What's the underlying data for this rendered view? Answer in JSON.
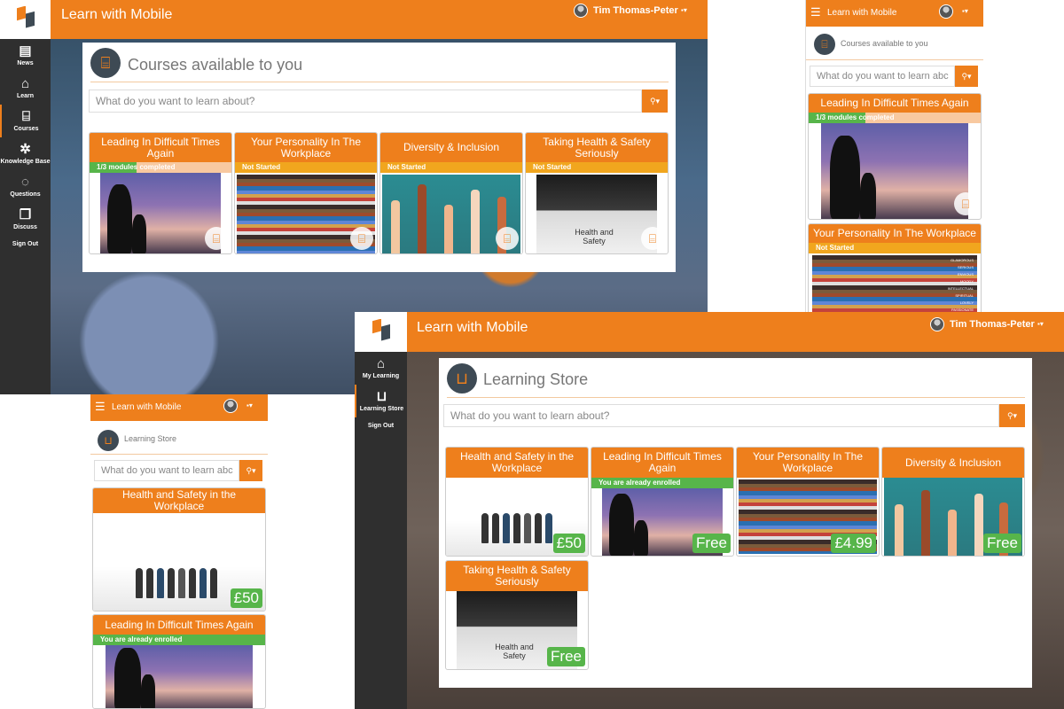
{
  "app": {
    "title": "Learn with Mobile",
    "user_name": "Tim Thomas-Peter"
  },
  "colors": {
    "accent": "#ee7f1c",
    "sidebar": "#2f2f2f",
    "success": "#57b54a",
    "warning": "#f1a61e"
  },
  "screen1": {
    "sidebar": [
      {
        "label": "News",
        "icon": "newspaper-icon"
      },
      {
        "label": "Learn",
        "icon": "graduation-cap-icon"
      },
      {
        "label": "Courses",
        "icon": "institution-icon"
      },
      {
        "label": "Knowledge Base",
        "icon": "atom-icon"
      },
      {
        "label": "Questions",
        "icon": "lightbulb-icon"
      },
      {
        "label": "Discuss",
        "icon": "chat-icon"
      },
      {
        "label": "Sign Out",
        "icon": ""
      }
    ],
    "page_title": "Courses available to you",
    "search_placeholder": "What do you want to learn about?",
    "courses": [
      {
        "title": "Leading In Difficult Times Again",
        "status": "1/3 modules completed",
        "progress": 0.33
      },
      {
        "title": "Your Personality In The Workplace",
        "status": "Not Started"
      },
      {
        "title": "Diversity & Inclusion",
        "status": "Not Started"
      },
      {
        "title": "Taking Health & Safety Seriously",
        "status": "Not Started"
      }
    ]
  },
  "mobile1": {
    "page_title": "Courses available to you",
    "search_placeholder": "What do you want to learn abc",
    "courses": [
      {
        "title": "Leading In Difficult Times Again",
        "status": "1/3 modules completed",
        "progress": 0.33
      },
      {
        "title": "Your Personality In The Workplace",
        "status": "Not Started"
      }
    ],
    "pencil_labels": [
      "GLAMOROUS",
      "SERIOUS",
      "ENVIOUS",
      "MOODY",
      "INTELLECTUAL",
      "SPIRITUAL",
      "LOVELY",
      "PASSIONATE"
    ]
  },
  "mobile2": {
    "page_title": "Learning Store",
    "search_placeholder": "What do you want to learn abc",
    "courses": [
      {
        "title": "Health and Safety in the Workplace",
        "price": "£50"
      },
      {
        "title": "Leading In Difficult Times Again",
        "status": "You are already enrolled"
      }
    ]
  },
  "screen2": {
    "sidebar": [
      {
        "label": "My Learning",
        "icon": "graduation-cap-icon"
      },
      {
        "label": "Learning Store",
        "icon": "shopping-bag-icon"
      },
      {
        "label": "Sign Out",
        "icon": ""
      }
    ],
    "page_title": "Learning Store",
    "search_placeholder": "What do you want to learn about?",
    "courses": [
      {
        "title": "Health and Safety in the Workplace",
        "price": "£50"
      },
      {
        "title": "Leading In Difficult Times Again",
        "status": "You are already enrolled",
        "price": "Free"
      },
      {
        "title": "Your Personality In The Workplace",
        "price": "£4.99"
      },
      {
        "title": "Diversity & Inclusion",
        "price": "Free"
      },
      {
        "title": "Taking Health & Safety Seriously",
        "price": "Free"
      }
    ]
  },
  "image_text": {
    "health_safety": "Health and Safety"
  }
}
